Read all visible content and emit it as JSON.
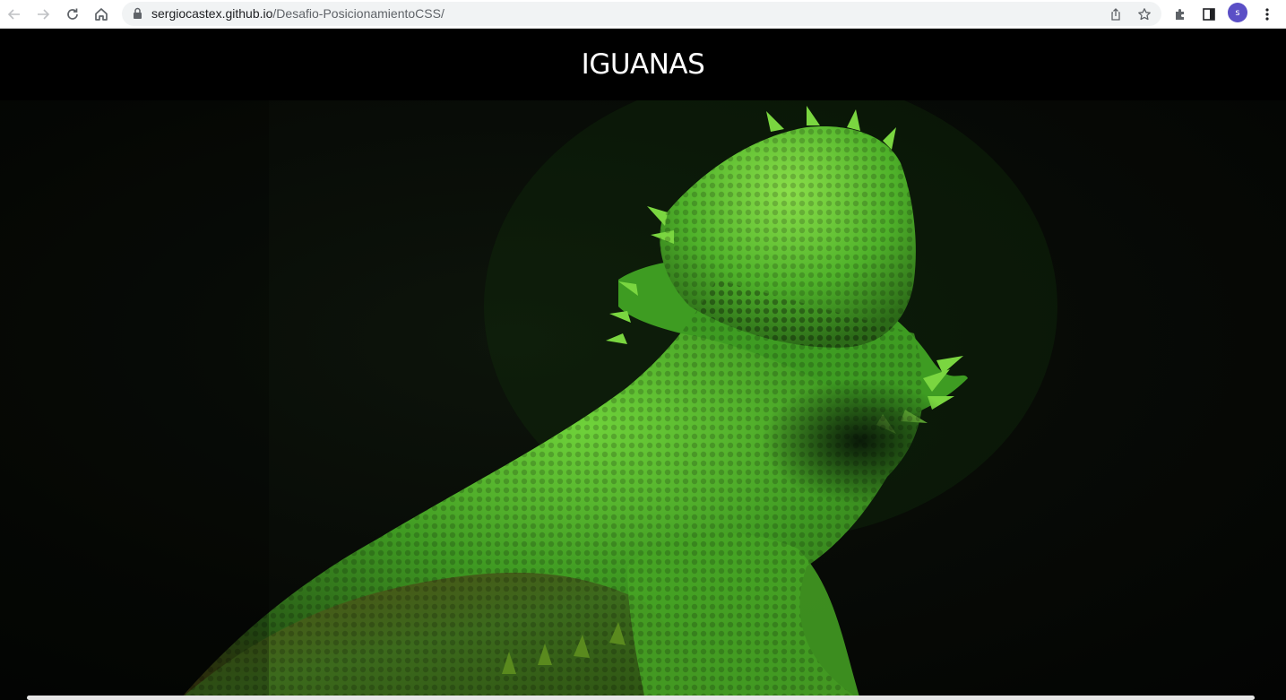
{
  "browser": {
    "url_host": "sergiocastex.github.io",
    "url_path": "/Desafio-PosicionamientoCSS/",
    "profile_initial": "s",
    "icons": [
      "back-icon",
      "forward-icon",
      "reload-icon",
      "home-icon",
      "lock-icon",
      "share-icon",
      "bookmark-star-icon",
      "extensions-icon",
      "side-panel-icon",
      "more-menu-icon"
    ]
  },
  "page": {
    "title": "IGUANAS",
    "hero_image": "bearded-dragon-lizard-photo",
    "colors": {
      "header_bg": "#000000",
      "title_color": "#ffffff",
      "lizard_green": "#5fbf2a"
    }
  }
}
